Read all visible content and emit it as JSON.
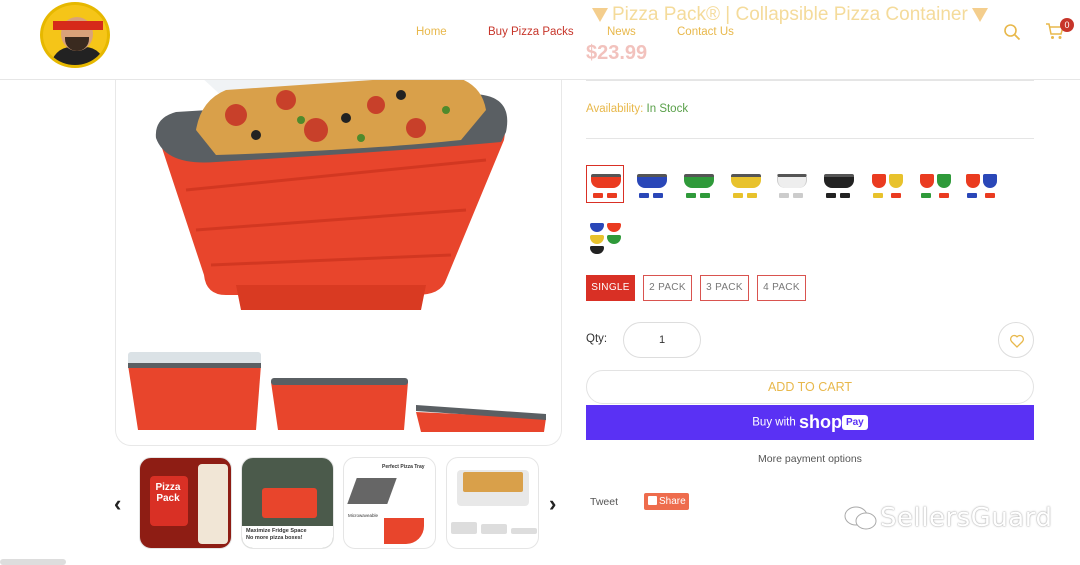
{
  "header": {
    "logo_name": "pizza-pack-mascot-logo",
    "nav": [
      {
        "label": "Home"
      },
      {
        "label": "Buy Pizza Packs"
      },
      {
        "label": "News"
      },
      {
        "label": "Contact Us"
      }
    ],
    "cart_count": "0",
    "icons": [
      "search-icon",
      "cart-icon"
    ]
  },
  "product": {
    "title": "Pizza Pack® | Collapsible Pizza Container",
    "price": "$23.99",
    "availability_label": "Availability:",
    "availability_value": "In Stock",
    "swatch_colors": [
      "#e8452c",
      "#2a47b8",
      "#2f9a3a",
      "#e8c22c",
      "#dddddd",
      "#222222",
      "multi",
      "multi",
      "multi",
      "multi"
    ],
    "pack_options": [
      {
        "label": "SINGLE",
        "selected": true
      },
      {
        "label": "2 PACK",
        "selected": false
      },
      {
        "label": "3 PACK",
        "selected": false
      },
      {
        "label": "4 PACK",
        "selected": false
      }
    ],
    "qty_label": "Qty:",
    "qty_value": "1",
    "add_to_cart": "ADD TO CART",
    "buy_with": "Buy with",
    "shop_word": "shop",
    "pay_word": "Pay",
    "more_payment": "More payment options",
    "tweet": "Tweet",
    "share": "Share"
  },
  "thumbnails": {
    "thumb1_brand": "Pizza Pack",
    "thumb2_caption": "Maximize Fridge Space",
    "thumb2_caption2": "No more pizza boxes!",
    "thumb3_caption": "Perfect Pizza Tray",
    "thumb3_caption2": "Microwaveable"
  },
  "watermark": "SellersGuard",
  "colors": {
    "accent_red": "#d93025",
    "gold": "#e8b84b",
    "shoppay_purple": "#5a31f4",
    "stock_green": "#5aa04a",
    "container_red": "#ea3b20",
    "rim_gray": "#5a5f63"
  }
}
